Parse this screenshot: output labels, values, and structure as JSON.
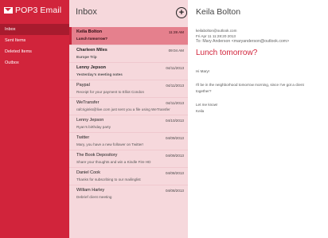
{
  "app": {
    "brand": "POP3 Email",
    "folders": [
      "Inbox",
      "Sent Items",
      "Deleted Items",
      "Outbox"
    ]
  },
  "inbox": {
    "title": "Inbox",
    "compose_symbol": "+",
    "messages": [
      {
        "sender": "Keila Bolton",
        "subject": "Lunch tomorrow?",
        "date": "11:28 AM"
      },
      {
        "sender": "Charleen Miles",
        "subject": "Europe Trip",
        "date": "09:04 AM"
      },
      {
        "sender": "Lenny Jepson",
        "subject": "Yesterday's meeting notes",
        "date": "04/11/2013"
      },
      {
        "sender": "Paypal",
        "subject": "Receipt for your payment to Elliot Condon",
        "date": "04/11/2013"
      },
      {
        "sender": "WeTransfer",
        "subject": "rafcriginks@live.com just sent you a file using WeTransfer",
        "date": "04/11/2013"
      },
      {
        "sender": "Lenny Jepson",
        "subject": "Ryan's birthday party",
        "date": "04/10/2013"
      },
      {
        "sender": "Twitter",
        "subject": "Mary, you have a new follower on Twitter!",
        "date": "04/09/2013"
      },
      {
        "sender": "The Book Depository",
        "subject": "Share your thoughts and win a Kindle Fire HD",
        "date": "04/09/2013"
      },
      {
        "sender": "Daniel Cook",
        "subject": "Thanks for subscribing to our mailinglist",
        "date": "04/08/2013"
      },
      {
        "sender": "William Harley",
        "subject": "Debrief client meeting",
        "date": "04/08/2013"
      }
    ]
  },
  "reading": {
    "sender_name": "Keila Bolton",
    "sender_email": "keilabolton@outlook.com",
    "sent_date": "Fri Apr 11 11:28:20 2013",
    "to": "To: Mary Anderson <maryanderson@outlook.com>",
    "subject": "Lunch tomorrow?",
    "greeting": "Hi Mary!",
    "body_line1": "I'll be in the neighborhood tomorrow morning, since I've got a client",
    "body_line2": "together?",
    "closing": "Let me know!",
    "signature": "Keila"
  },
  "colors": {
    "accent": "#d1243b",
    "sidebar_active": "#a81b2e",
    "list_bg": "#f6d8dc",
    "selected_row": "#e5808d"
  },
  "icons": {
    "brand": "envelope-icon",
    "compose": "plus-circle-icon"
  }
}
